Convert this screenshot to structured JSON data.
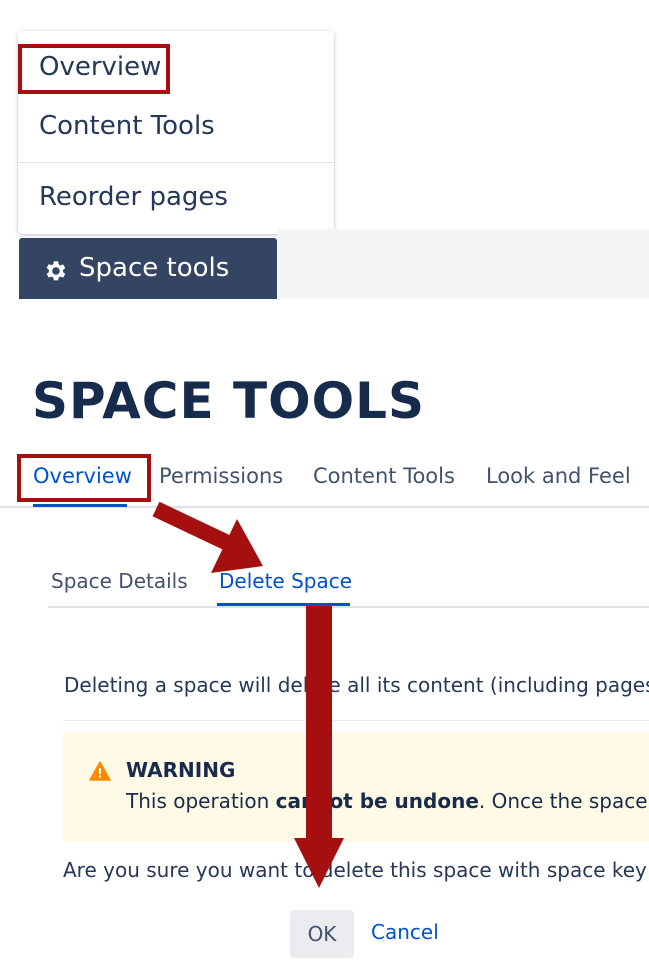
{
  "menu": {
    "items": [
      "Overview",
      "Content Tools",
      "Reorder pages"
    ]
  },
  "space_tools_button": {
    "label": "Space tools",
    "icon": "gear-icon"
  },
  "page_title": "SPACE TOOLS",
  "tabs": [
    {
      "label": "Overview",
      "active": true
    },
    {
      "label": "Permissions",
      "active": false
    },
    {
      "label": "Content Tools",
      "active": false
    },
    {
      "label": "Look and Feel",
      "active": false
    }
  ],
  "subtabs": [
    {
      "label": "Space Details",
      "active": false
    },
    {
      "label": "Delete Space",
      "active": true
    }
  ],
  "description": "Deleting a space will delete all its content (including pages",
  "warning": {
    "icon": "warning-triangle-icon",
    "title": "WARNING",
    "text_before": "This operation ",
    "text_bold": "cannot be undone",
    "text_after": ". Once the space"
  },
  "confirm_question": "Are you sure you want to delete this space with space key",
  "buttons": {
    "ok": "OK",
    "cancel": "Cancel"
  },
  "colors": {
    "annotation": "#a50f0f",
    "accent": "#0052cc",
    "nav_dark": "#344563",
    "warning_bg": "#fffae6",
    "warning_icon": "#ff8b00"
  }
}
